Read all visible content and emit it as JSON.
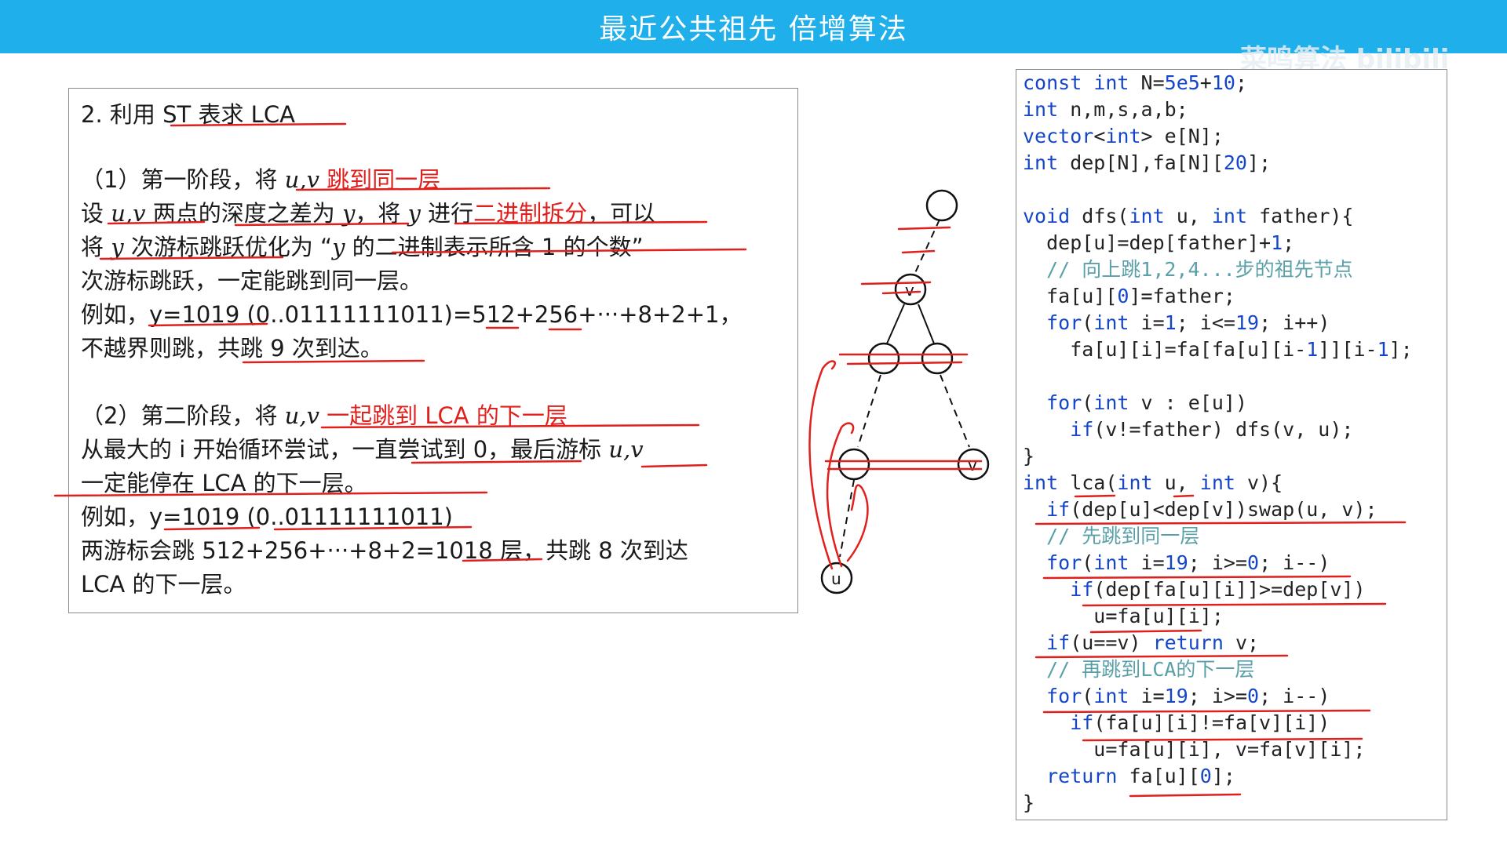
{
  "header": {
    "title": "最近公共祖先 倍增算法"
  },
  "watermark": "菜鸣算法 bilibili",
  "explanation": {
    "heading": "2.  利用 ST 表求 LCA",
    "stage1_title_a": "（1）第一阶段，将 ",
    "stage1_title_var": "u,v",
    "stage1_title_b": " 跳到同一层",
    "l1_a": "设 ",
    "l1_var1": "u,v",
    "l1_b": " 两点的深度之差为 ",
    "l1_var2": "y",
    "l1_c": "，将 ",
    "l1_var3": "y",
    "l1_d": " 进行",
    "l1_red": "二进制拆分",
    "l1_e": "，可以",
    "l2_a": "将 ",
    "l2_var": "y",
    "l2_b": " 次游标跳跃优化为 “",
    "l2_var2": "y",
    "l2_c": " 的二进制表示所含 1 的个数”",
    "l3": "次游标跳跃，一定能跳到同一层。",
    "l4": "例如，y=1019 (0..01111111011)=512+256+···+8+2+1，",
    "l5": "不越界则跳，共跳 9 次到达。",
    "stage2_title_a": "（2）第二阶段，将 ",
    "stage2_title_var": "u,v",
    "stage2_title_b": " 一起跳到 LCA 的下一层",
    "m1_a": "从最大的 i 开始循环尝试，一直尝试到 0，最后游标 ",
    "m1_var": "u,v",
    "m2": "一定能停在 LCA 的下一层。",
    "m3": "例如，y=1019 (0..01111111011)",
    "m4": "两游标会跳 512+256+···+8+2=1018 层，共跳 8 次到达",
    "m5": "LCA 的下一层。"
  },
  "tree": {
    "node_v_label": "v",
    "node_v2_label": "v",
    "node_u_label": "u"
  },
  "code": {
    "lines": [
      "const int N=5e5+10;",
      "int n,m,s,a,b;",
      "vector<int> e[N];",
      "int dep[N],fa[N][20];",
      "",
      "void dfs(int u, int father){",
      "  dep[u]=dep[father]+1;",
      "  // 向上跳1,2,4...步的祖先节点",
      "  fa[u][0]=father;",
      "  for(int i=1; i<=19; i++)",
      "    fa[u][i]=fa[fa[u][i-1]][i-1];",
      "",
      "  for(int v : e[u])",
      "    if(v!=father) dfs(v, u);",
      "}",
      "int lca(int u, int v){",
      "  if(dep[u]<dep[v])swap(u, v);",
      "  // 先跳到同一层",
      "  for(int i=19; i>=0; i--)",
      "    if(dep[fa[u][i]]>=dep[v])",
      "      u=fa[u][i];",
      "  if(u==v) return v;",
      "  // 再跳到LCA的下一层",
      "  for(int i=19; i>=0; i--)",
      "    if(fa[u][i]!=fa[v][i])",
      "      u=fa[u][i], v=fa[v][i];",
      "  return fa[u][0];",
      "}"
    ]
  },
  "colors": {
    "header_bg": "#1fb0ec",
    "annotation_red": "#e0201c",
    "keyword_blue": "#1646c8",
    "comment": "#5aa0a8"
  }
}
